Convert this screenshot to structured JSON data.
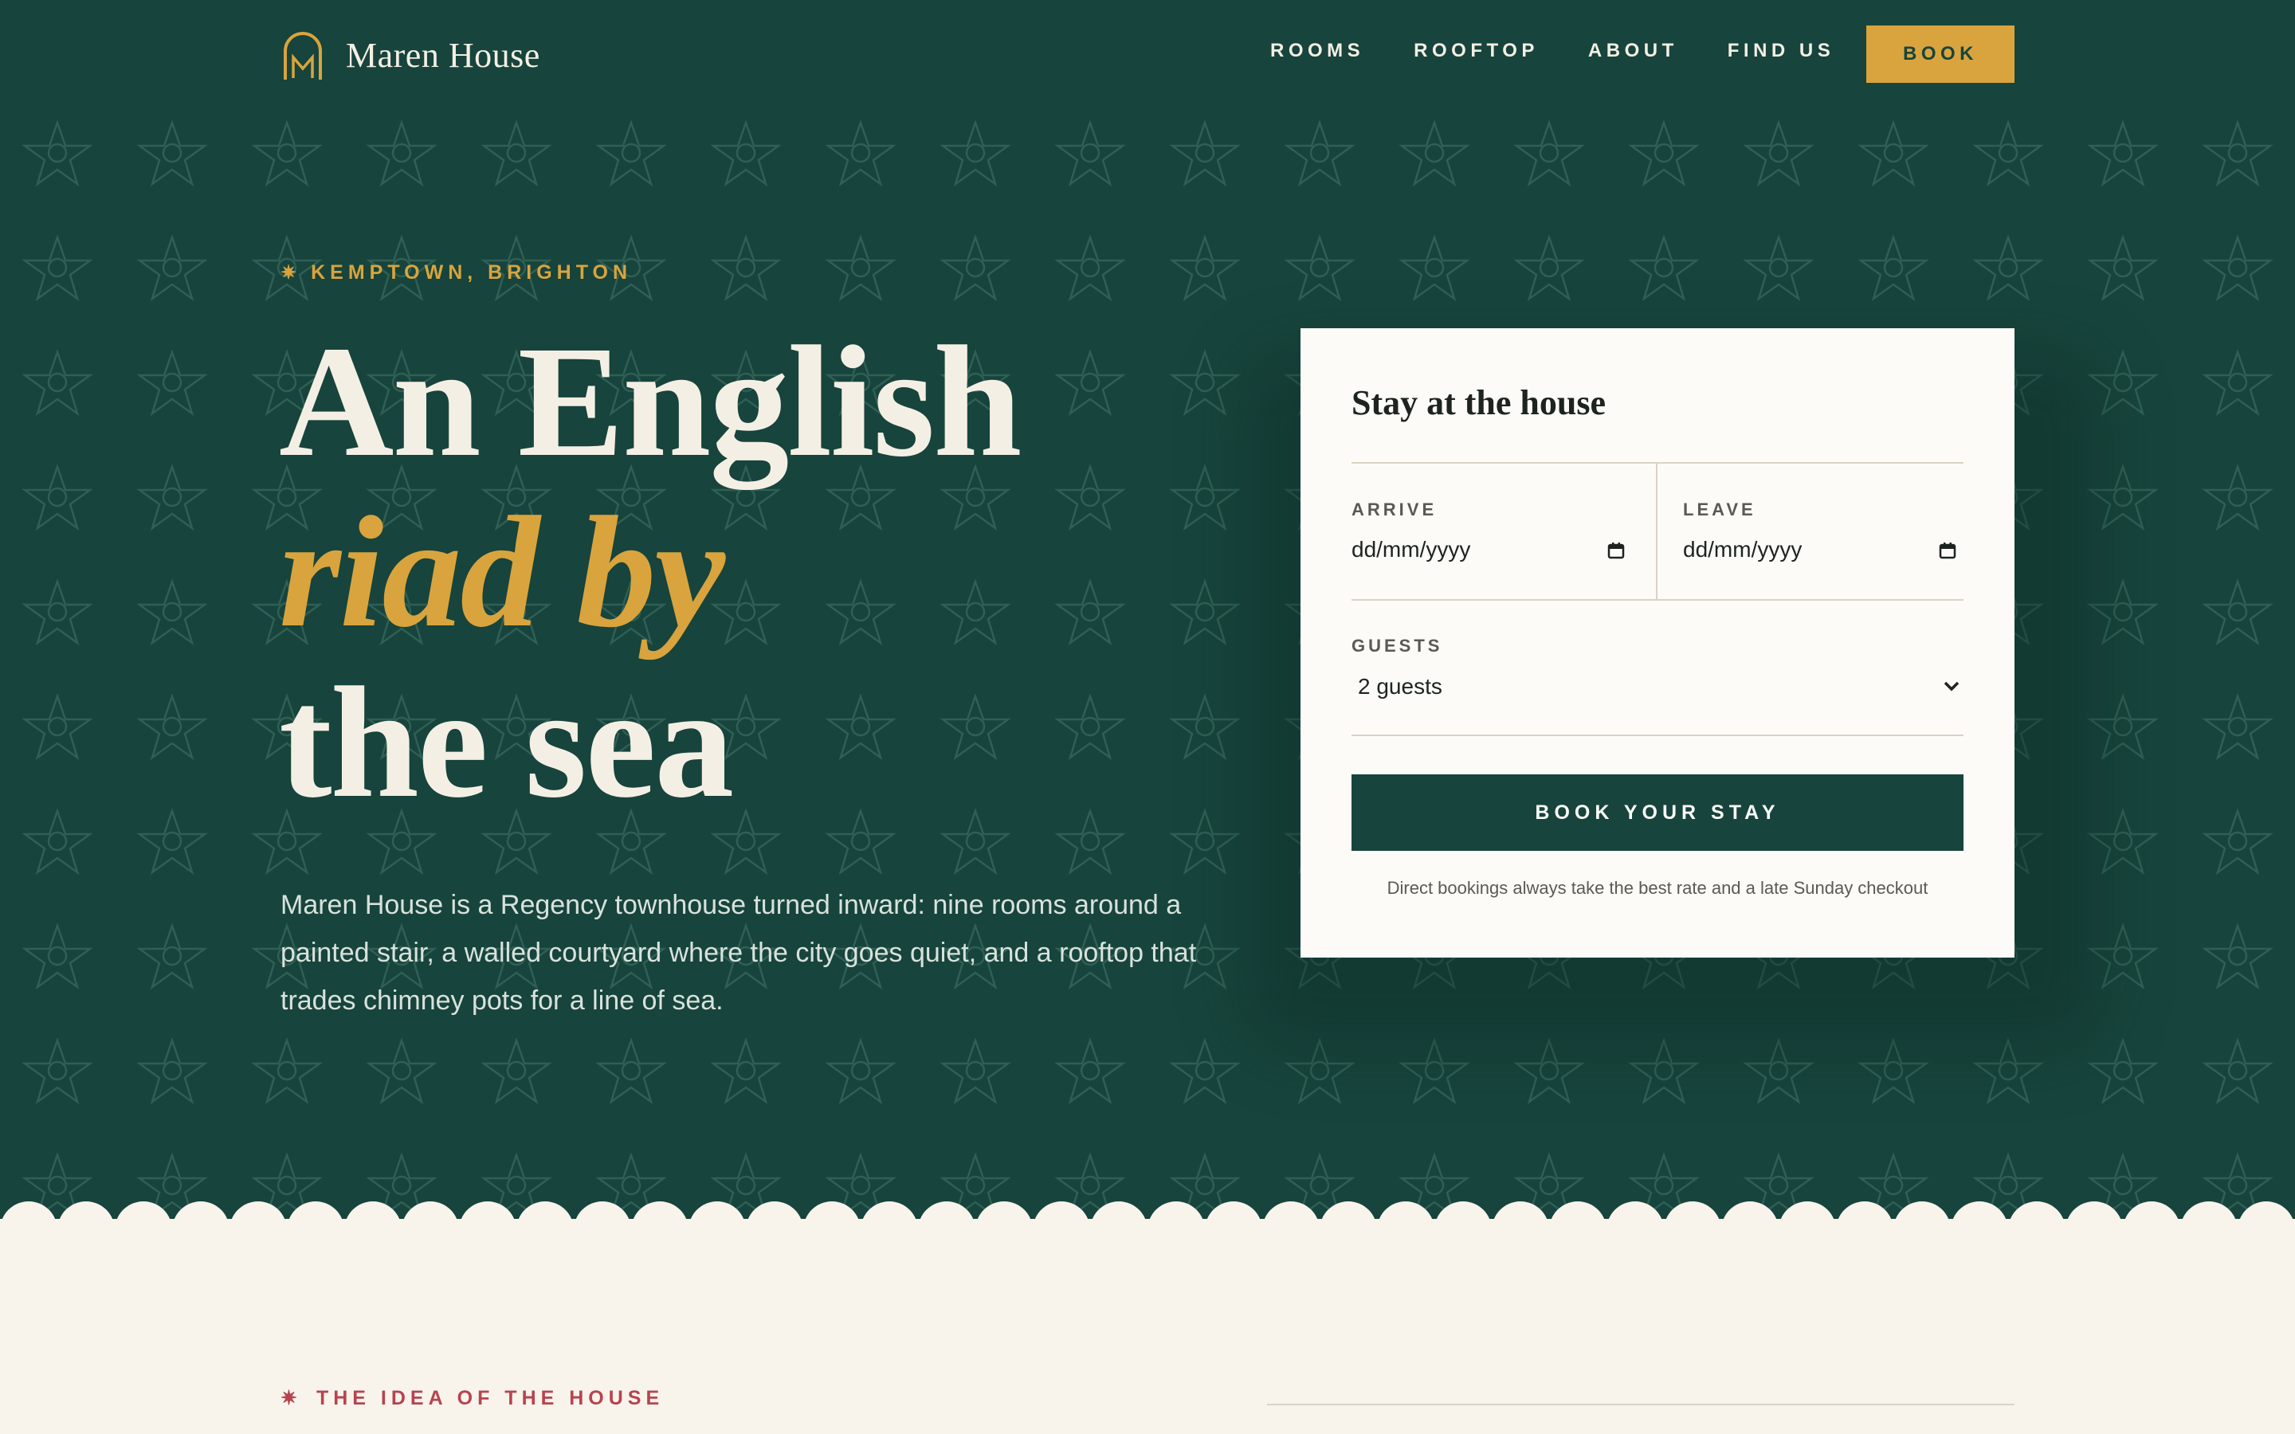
{
  "brand": {
    "name": "Maren House",
    "logo_letter": "M"
  },
  "nav": {
    "links": [
      "ROOMS",
      "ROOFTOP",
      "ABOUT",
      "FIND US"
    ],
    "book_label": "BOOK"
  },
  "hero": {
    "eyebrow_icon": "✷",
    "eyebrow": "KEMPTOWN, BRIGHTON",
    "headline_line1": "An English",
    "headline_line2": "riad by",
    "headline_line3": "the sea",
    "lede": "Maren House is a Regency townhouse turned inward: nine rooms around a painted stair, a walled courtyard where the city goes quiet, and a rooftop that trades chimney pots for a line of sea."
  },
  "booking": {
    "title": "Stay at the house",
    "arrive_label": "ARRIVE",
    "arrive_placeholder": "dd/mm/yyyy",
    "leave_label": "LEAVE",
    "leave_placeholder": "dd/mm/yyyy",
    "guests_label": "GUESTS",
    "guests_value": "2 guests",
    "submit_label": "BOOK YOUR STAY",
    "note": "Direct bookings always take the best rate and a late Sunday checkout"
  },
  "section": {
    "eyebrow_icon": "✷",
    "eyebrow": "THE IDEA OF THE HOUSE"
  },
  "colors": {
    "hero_bg": "#17443c",
    "gold": "#d9a43d",
    "cream": "#f8f4ec",
    "card_bg": "#fcfbf7",
    "rose": "#b8434f"
  },
  "icons": {
    "logo": "arch-m-icon",
    "calendar": "calendar-icon",
    "chevron": "chevron-down-icon",
    "star": "star-pattern-icon"
  }
}
